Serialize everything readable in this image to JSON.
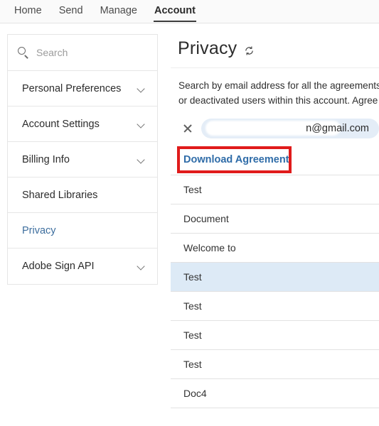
{
  "topnav": {
    "items": [
      {
        "label": "Home",
        "active": false
      },
      {
        "label": "Send",
        "active": false
      },
      {
        "label": "Manage",
        "active": false
      },
      {
        "label": "Account",
        "active": true
      }
    ]
  },
  "sidebar": {
    "search": {
      "placeholder": "Search",
      "icon": "search-icon"
    },
    "items": [
      {
        "label": "Personal Preferences",
        "chevron": true,
        "selected": false
      },
      {
        "label": "Account Settings",
        "chevron": true,
        "selected": false
      },
      {
        "label": "Billing Info",
        "chevron": true,
        "selected": false
      },
      {
        "label": "Shared Libraries",
        "chevron": false,
        "selected": false
      },
      {
        "label": "Privacy",
        "chevron": false,
        "selected": true
      },
      {
        "label": "Adobe Sign API",
        "chevron": true,
        "selected": false
      }
    ]
  },
  "main": {
    "title": "Privacy",
    "refresh_icon": "refresh-icon",
    "description_line1": "Search by email address for all the agreements",
    "description_line2": "or deactivated users within this account. Agree",
    "chip": {
      "remove_icon": "close-icon",
      "email_visible": "n@gmail.com",
      "redacted": true
    },
    "download_label": "Download Agreement",
    "rows": [
      {
        "label": "Test",
        "selected": false
      },
      {
        "label": "Document",
        "selected": false
      },
      {
        "label": "Welcome to",
        "selected": false
      },
      {
        "label": "Test",
        "selected": true
      },
      {
        "label": "Test",
        "selected": false
      },
      {
        "label": "Test",
        "selected": false
      },
      {
        "label": "Test",
        "selected": false
      },
      {
        "label": "Doc4",
        "selected": false
      }
    ]
  },
  "colors": {
    "accent_link": "#2f6ca8",
    "sidebar_active": "#3d6e9e",
    "highlight_box": "#e01b1b",
    "row_selected": "#ddeaf6",
    "chip_bg": "#e4edf7"
  }
}
